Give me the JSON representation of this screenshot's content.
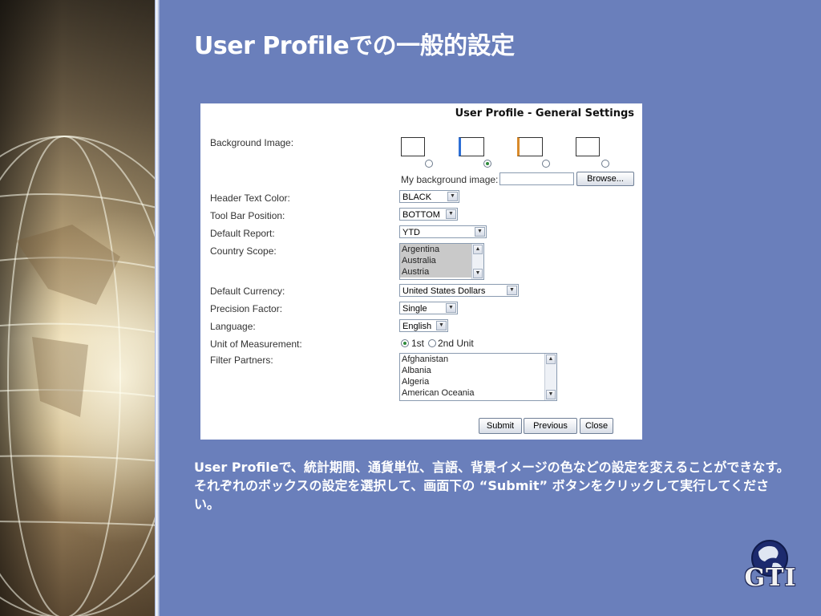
{
  "slide": {
    "title": "User Profileでの一般的設定",
    "caption": "User Profileで、統計期間、通貨単位、言語、背景イメージの色などの設定を変えることができなす。それぞれのボックスの設定を選択して、画面下の “Submit” ボタンをクリックして実行してください。",
    "logo_text": "GTI"
  },
  "form": {
    "title": "User Profile - General Settings",
    "labels": {
      "background_image": "Background Image:",
      "my_background_image": "My background image:",
      "header_text_color": "Header Text Color:",
      "tool_bar_position": "Tool Bar Position:",
      "default_report": "Default Report:",
      "country_scope": "Country Scope:",
      "default_currency": "Default Currency:",
      "precision_factor": "Precision Factor:",
      "language": "Language:",
      "unit_of_measurement": "Unit of Measurement:",
      "filter_partners": "Filter Partners:"
    },
    "background_selected_index": 1,
    "browse_label": "Browse...",
    "values": {
      "header_text_color": "BLACK",
      "tool_bar_position": "BOTTOM",
      "default_report": "YTD",
      "default_currency": "United States Dollars",
      "precision_factor": "Single",
      "language": "English"
    },
    "country_scope_items": [
      "Argentina",
      "Australia",
      "Austria"
    ],
    "unit_options": [
      "1st",
      "2nd Unit"
    ],
    "unit_selected": "1st",
    "filter_partner_items": [
      "Afghanistan",
      "Albania",
      "Algeria",
      "American Oceania"
    ],
    "buttons": {
      "submit": "Submit",
      "previous": "Previous",
      "close": "Close"
    }
  }
}
